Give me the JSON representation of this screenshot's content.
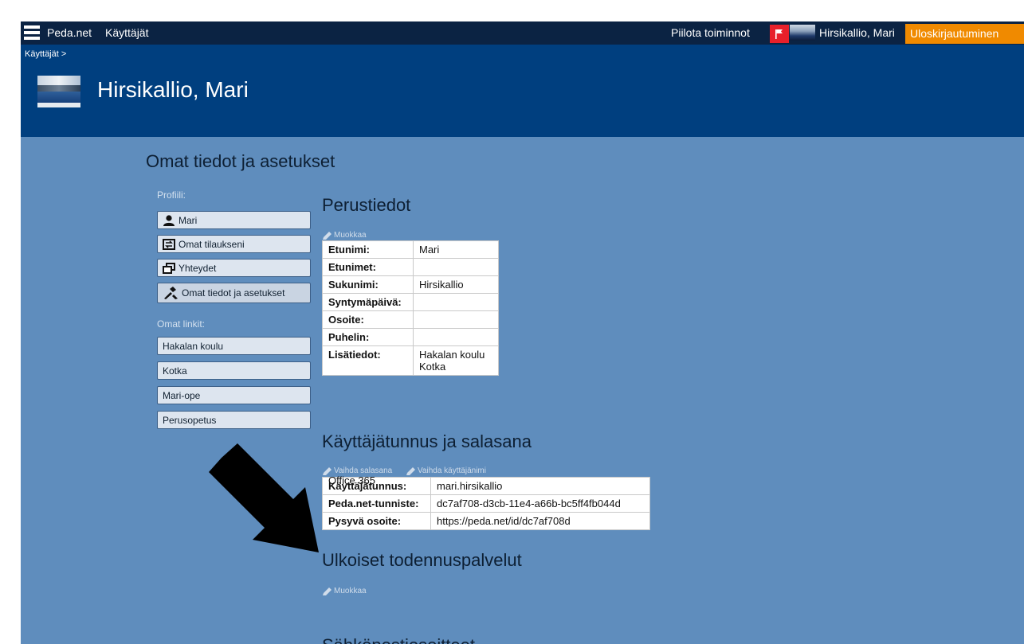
{
  "topbar": {
    "site": "Peda.net",
    "users": "Käyttäjät",
    "hide_functions": "Piilota toiminnot",
    "user_name": "Hirsikallio, Mari",
    "logout": "Uloskirjautuminen",
    "accent": "#f08a00",
    "flag_color": "#e8202a"
  },
  "breadcrumb": "Käyttäjät >",
  "page_title": "Hirsikallio, Mari",
  "main": {
    "heading": "Omat tiedot ja asetukset",
    "profile_label": "Profiili:",
    "profile_items": [
      {
        "label": "Mari",
        "icon": "user-icon"
      },
      {
        "label": "Omat tilaukseni",
        "icon": "subscriptions-icon"
      },
      {
        "label": "Yhteydet",
        "icon": "connections-icon"
      },
      {
        "label": "Omat tiedot ja asetukset",
        "icon": "settings-icon"
      }
    ],
    "links_label": "Omat linkit:",
    "links": [
      "Hakalan koulu",
      "Kotka",
      "Mari-ope",
      "Perusopetus"
    ]
  },
  "basic_info": {
    "title": "Perustiedot",
    "edit": "Muokkaa",
    "rows": [
      {
        "k": "Etunimi:",
        "v": "Mari"
      },
      {
        "k": "Etunimet:",
        "v": ""
      },
      {
        "k": "Sukunimi:",
        "v": "Hirsikallio"
      },
      {
        "k": "Syntymäpäivä:",
        "v": ""
      },
      {
        "k": "Osoite:",
        "v": ""
      },
      {
        "k": "Puhelin:",
        "v": ""
      },
      {
        "k": "Lisätiedot:",
        "v": "Hakalan koulu",
        "v2": "Kotka"
      }
    ]
  },
  "account": {
    "title": "Käyttäjätunnus ja salasana",
    "change_password": "Vaihda salasana",
    "change_username": "Vaihda käyttäjänimi",
    "rows": [
      {
        "k": "Käyttäjätunnus:",
        "v": "mari.hirsikallio"
      },
      {
        "k": "Peda.net-tunniste:",
        "v": "dc7af708-d3cb-11e4-a66b-bc5ff4fb044d"
      },
      {
        "k": "Pysyvä osoite:",
        "v": "https://peda.net/id/dc7af708d"
      }
    ]
  },
  "external": {
    "title": "Ulkoiset todennuspalvelut",
    "edit": "Muokkaa",
    "service": "Office 365"
  },
  "emails": {
    "title": "Sähköpostiosoitteet"
  }
}
